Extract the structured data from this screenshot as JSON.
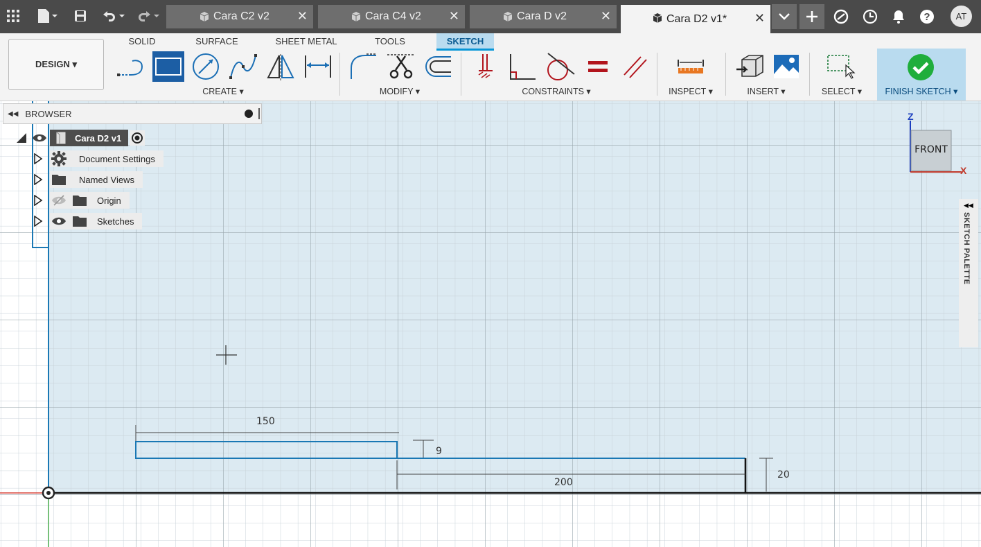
{
  "tabs": [
    {
      "label": "Cara C2 v2",
      "close": "✕"
    },
    {
      "label": "Cara C4 v2",
      "close": "✕"
    },
    {
      "label": "Cara D v2",
      "close": "✕"
    },
    {
      "label": "Cara D2 v1*",
      "close": "✕",
      "active": true
    }
  ],
  "user": {
    "initials": "AT"
  },
  "workspace": {
    "label": "DESIGN ▾"
  },
  "ribbon_tabs": [
    "SOLID",
    "SURFACE",
    "SHEET METAL",
    "TOOLS",
    "SKETCH"
  ],
  "groups": {
    "create": "CREATE ▾",
    "modify": "MODIFY ▾",
    "constraints": "CONSTRAINTS ▾",
    "inspect": "INSPECT ▾",
    "insert": "INSERT ▾",
    "select": "SELECT ▾",
    "finish": "FINISH SKETCH ▾"
  },
  "browser": {
    "title": "BROWSER",
    "root": "Cara D2 v1",
    "items": [
      {
        "label": "Document Settings",
        "icon": "gear-icon"
      },
      {
        "label": "Named Views",
        "icon": "folder-icon"
      },
      {
        "label": "Origin",
        "icon": "folder-icon",
        "hidden": true
      },
      {
        "label": "Sketches",
        "icon": "folder-icon"
      }
    ]
  },
  "viewcube": {
    "face": "FRONT",
    "axis_z": "Z",
    "axis_x": "X"
  },
  "palette": {
    "label": "SKETCH PALETTE"
  },
  "dimensions": {
    "d150": "150",
    "d9": "9",
    "d200": "200",
    "d20": "20"
  },
  "colors": {
    "accent": "#0696d7",
    "sketch_line": "#1a78b4",
    "grid_bg": "#dceaf2",
    "title_bar": "#4a4a4a"
  }
}
